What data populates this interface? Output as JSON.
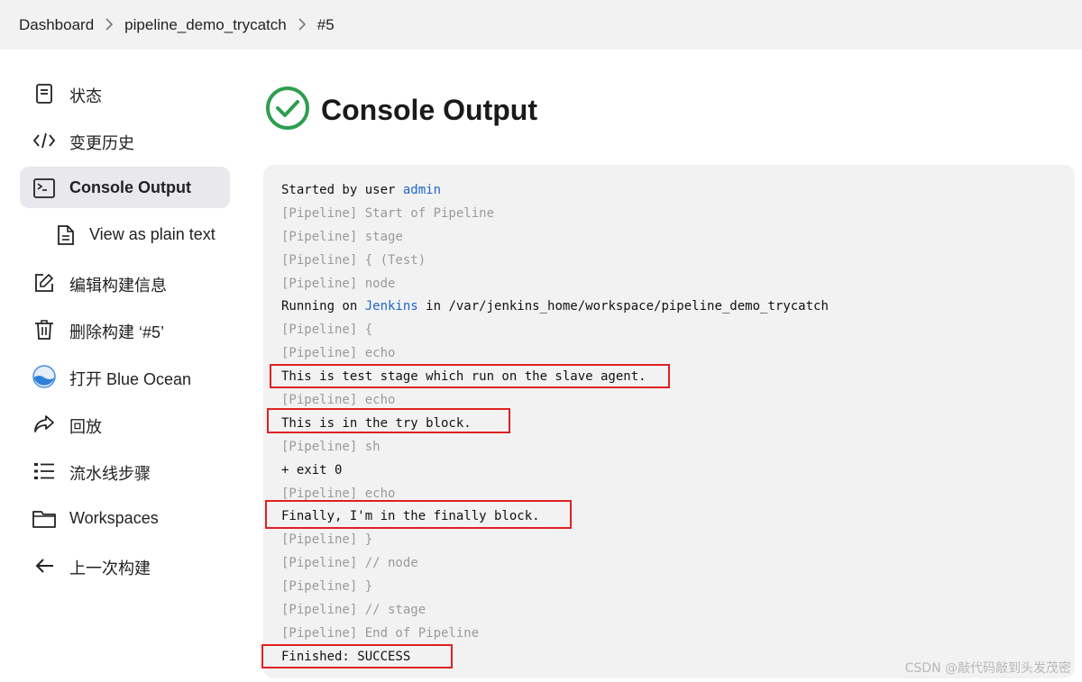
{
  "breadcrumb": {
    "items": [
      "Dashboard",
      "pipeline_demo_trycatch",
      "#5"
    ]
  },
  "sidebar": {
    "items": [
      {
        "label": "状态",
        "icon": "document-icon"
      },
      {
        "label": "变更历史",
        "icon": "code-icon"
      },
      {
        "label": "Console Output",
        "icon": "terminal-icon",
        "active": true
      },
      {
        "label": "View as plain text",
        "icon": "file-text-icon",
        "sub": true
      },
      {
        "label": "编辑构建信息",
        "icon": "edit-icon"
      },
      {
        "label": "删除构建 ‘#5’",
        "icon": "trash-icon"
      },
      {
        "label": "打开 Blue Ocean",
        "icon": "blue-ocean-icon"
      },
      {
        "label": "回放",
        "icon": "replay-icon"
      },
      {
        "label": "流水线步骤",
        "icon": "steps-list-icon"
      },
      {
        "label": "Workspaces",
        "icon": "folder-icon"
      },
      {
        "label": "上一次构建",
        "icon": "arrow-left-icon"
      }
    ]
  },
  "page": {
    "title": "Console Output",
    "status": "success",
    "status_color": "#2e9e4f"
  },
  "console": {
    "lines": [
      {
        "pre": "Started by user ",
        "link": "admin",
        "post": "",
        "dim": false
      },
      {
        "pre": "[Pipeline] Start of Pipeline",
        "link": "",
        "post": "",
        "dim": true
      },
      {
        "pre": "[Pipeline] stage",
        "link": "",
        "post": "",
        "dim": true
      },
      {
        "pre": "[Pipeline] { (Test)",
        "link": "",
        "post": "",
        "dim": true
      },
      {
        "pre": "[Pipeline] node",
        "link": "",
        "post": "",
        "dim": true
      },
      {
        "pre": "Running on ",
        "link": "Jenkins",
        "post": " in /var/jenkins_home/workspace/pipeline_demo_trycatch",
        "dim": false
      },
      {
        "pre": "[Pipeline] {",
        "link": "",
        "post": "",
        "dim": true
      },
      {
        "pre": "[Pipeline] echo",
        "link": "",
        "post": "",
        "dim": true
      },
      {
        "pre": "This is test stage which run on the slave agent.",
        "link": "",
        "post": "",
        "dim": false,
        "highlight": true
      },
      {
        "pre": "[Pipeline] echo",
        "link": "",
        "post": "",
        "dim": true
      },
      {
        "pre": "This is in the try block.",
        "link": "",
        "post": "",
        "dim": false,
        "highlight": true
      },
      {
        "pre": "[Pipeline] sh",
        "link": "",
        "post": "",
        "dim": true
      },
      {
        "pre": "+ exit 0",
        "link": "",
        "post": "",
        "dim": false
      },
      {
        "pre": "[Pipeline] echo",
        "link": "",
        "post": "",
        "dim": true
      },
      {
        "pre": "Finally, I'm in the finally block.",
        "link": "",
        "post": "",
        "dim": false,
        "highlight": true
      },
      {
        "pre": "[Pipeline] }",
        "link": "",
        "post": "",
        "dim": true
      },
      {
        "pre": "[Pipeline] // node",
        "link": "",
        "post": "",
        "dim": true
      },
      {
        "pre": "[Pipeline] }",
        "link": "",
        "post": "",
        "dim": true
      },
      {
        "pre": "[Pipeline] // stage",
        "link": "",
        "post": "",
        "dim": true
      },
      {
        "pre": "[Pipeline] End of Pipeline",
        "link": "",
        "post": "",
        "dim": true
      },
      {
        "pre": "Finished: SUCCESS",
        "link": "",
        "post": "",
        "dim": false,
        "highlight": true
      }
    ],
    "link_color": "#1d66c9",
    "highlight_color": "#e02020"
  },
  "watermark": "CSDN @敲代码敲到头发茂密"
}
